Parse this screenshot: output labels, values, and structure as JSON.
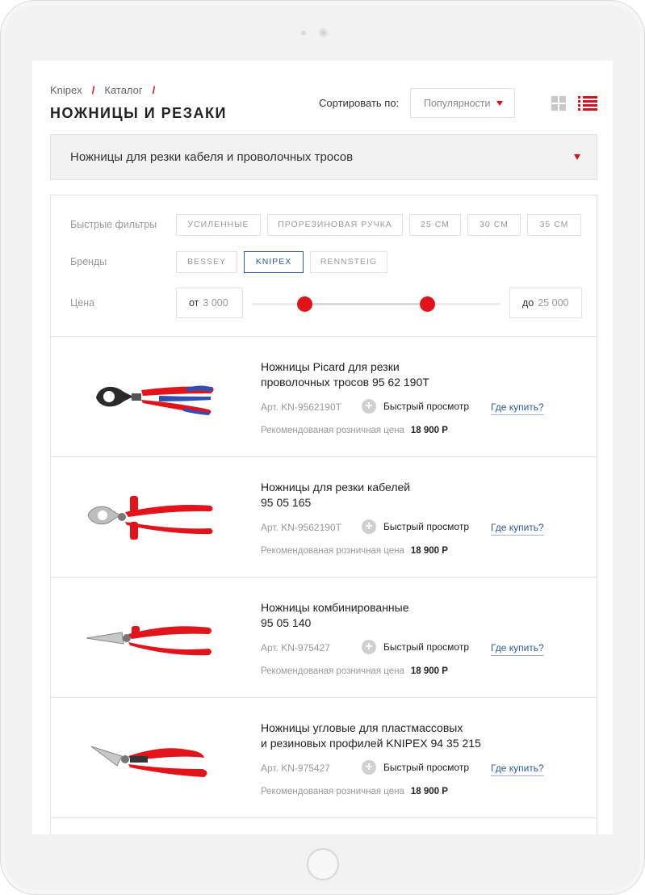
{
  "breadcrumb": {
    "items": [
      "Knipex",
      "Каталог"
    ],
    "separator": "/"
  },
  "page_title": "НОЖНИЦЫ И РЕЗАКИ",
  "sort": {
    "label": "Сортировать по:",
    "value": "Популярности"
  },
  "category": {
    "value": "Ножницы для резки кабеля и проволочных тросов"
  },
  "filters": {
    "quick_label": "Быстрые фильтры",
    "quick": [
      "Усиленные",
      "Прорезиновая ручка",
      "25 см",
      "30 см",
      "35 см"
    ],
    "brands_label": "Бренды",
    "brands": [
      "BESSEY",
      "KNIPEX",
      "RENNSTEIG"
    ],
    "active_brand": "KNIPEX",
    "price_label": "Цена",
    "price_from_prefix": "от",
    "price_from": "3 000",
    "price_to_prefix": "до",
    "price_to": "25 000"
  },
  "products": [
    {
      "name_line1": "Ножницы Picard для резки",
      "name_line2": "проволочных тросов 95 62 190T",
      "art": "Арт. KN-9562190T",
      "quick_view": "Быстрый просмотр",
      "where_to_buy": "Где купить?",
      "price_label": "Рекомендованая розничная цена",
      "price": "18 900 Р",
      "image": "wire-rope-cutter-red-blue"
    },
    {
      "name_line1": "Ножницы для резки кабелей",
      "name_line2": "95 05 165",
      "art": "Арт. KN-9562190T",
      "quick_view": "Быстрый просмотр",
      "where_to_buy": "Где купить?",
      "price_label": "Рекомендованая розничная цена",
      "price": "18 900 Р",
      "image": "cable-shears-red"
    },
    {
      "name_line1": "Ножницы комбинированные",
      "name_line2": "95 05 140",
      "art": "Арт. KN-975427",
      "quick_view": "Быстрый просмотр",
      "where_to_buy": "Где купить?",
      "price_label": "Рекомендованая розничная цена",
      "price": "18 900 Р",
      "image": "combination-shears-red"
    },
    {
      "name_line1": "Ножницы угловые для пластмассовых",
      "name_line2": "и резиновых профилей KNIPEX 94 35 215",
      "art": "Арт. KN-975427",
      "quick_view": "Быстрый просмотр",
      "where_to_buy": "Где купить?",
      "price_label": "Рекомендованая розничная цена",
      "price": "18 900 Р",
      "image": "angled-shears-red"
    }
  ],
  "colors": {
    "accent": "#e3131c",
    "link": "#2c5aa0"
  }
}
